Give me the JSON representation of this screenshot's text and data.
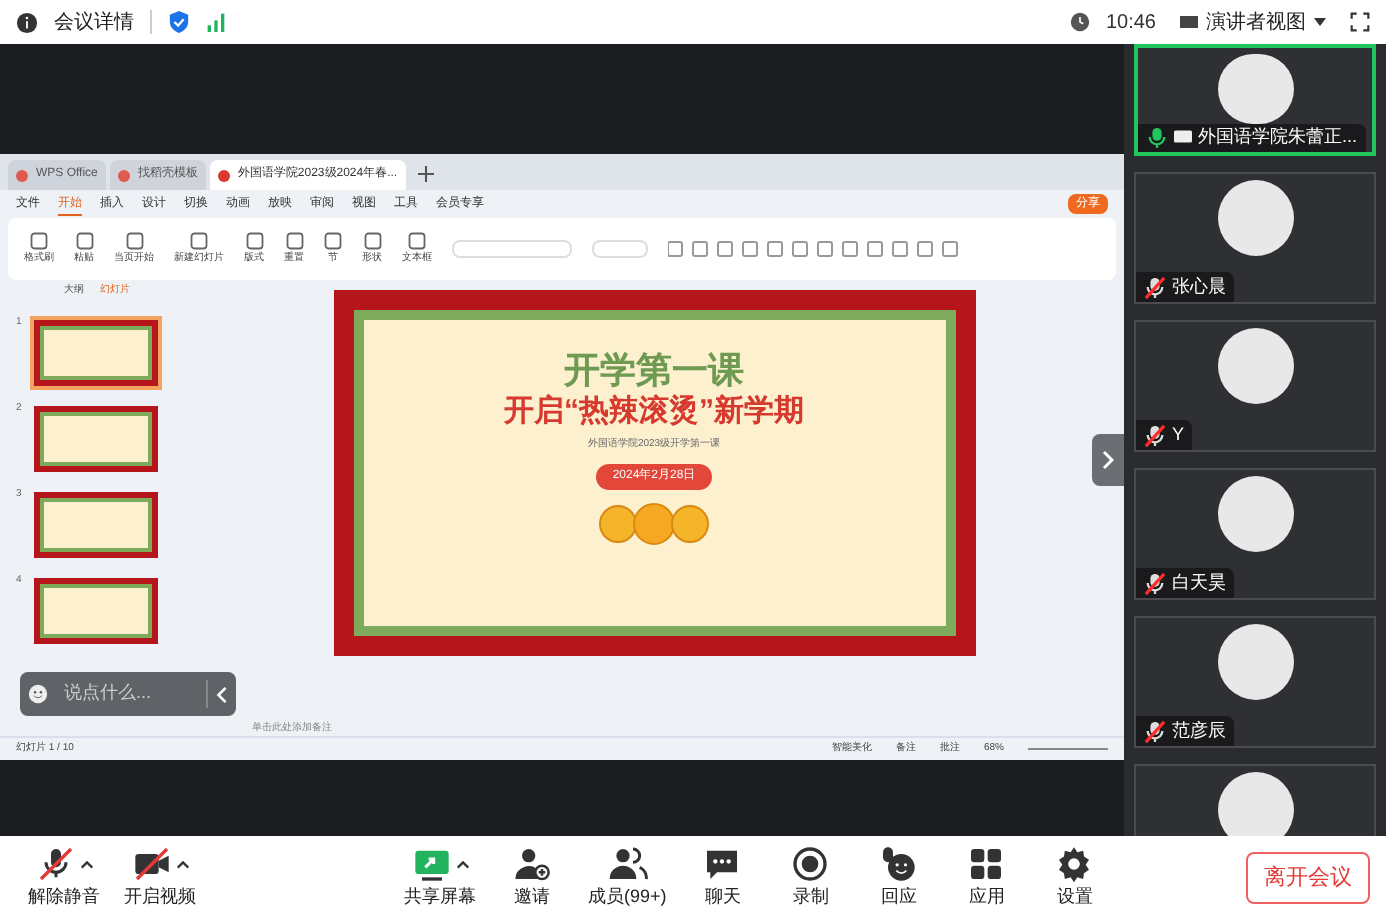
{
  "top_bar": {
    "meeting_info": "会议详情",
    "time": "10:46",
    "view_mode": "演讲者视图"
  },
  "wps": {
    "tabs": [
      {
        "label": "WPS Office",
        "selected": false
      },
      {
        "label": "找稻壳模板",
        "selected": false
      },
      {
        "label": "外国语学院2023级2024年春...",
        "selected": true
      }
    ],
    "menu": [
      {
        "label": "文件",
        "selected": false
      },
      {
        "label": "开始",
        "selected": true
      },
      {
        "label": "插入",
        "selected": false
      },
      {
        "label": "设计",
        "selected": false
      },
      {
        "label": "切换",
        "selected": false
      },
      {
        "label": "动画",
        "selected": false
      },
      {
        "label": "放映",
        "selected": false
      },
      {
        "label": "审阅",
        "selected": false
      },
      {
        "label": "视图",
        "selected": false
      },
      {
        "label": "工具",
        "selected": false
      },
      {
        "label": "会员专享",
        "selected": false
      }
    ],
    "share_button": "分享",
    "ribbon": [
      {
        "label": "格式刷"
      },
      {
        "label": "粘贴"
      },
      {
        "label": "当页开始"
      },
      {
        "label": "新建幻灯片"
      },
      {
        "label": "版式"
      },
      {
        "label": "重置"
      },
      {
        "label": "节"
      },
      {
        "label": "形状"
      },
      {
        "label": "文本框"
      }
    ],
    "pane_tabs": [
      {
        "label": "大纲",
        "selected": false
      },
      {
        "label": "幻灯片",
        "selected": true
      }
    ],
    "thumbnails": [
      {
        "number": "1",
        "selected": true
      },
      {
        "number": "2",
        "selected": false
      },
      {
        "number": "3",
        "selected": false
      },
      {
        "number": "4",
        "selected": false
      }
    ],
    "slide": {
      "title": "开学第一课",
      "subtitle": "开启“热辣滚烫”新学期",
      "caption": "外国语学院2023级开学第一课",
      "date": "2024年2月28日"
    },
    "notes_placeholder": "单击此处添加备注",
    "status": {
      "slide_count": "幻灯片 1 / 10",
      "beautify": "智能美化",
      "notes": "备注",
      "comments": "批注",
      "zoom": "68%"
    },
    "chat_placeholder": "说点什么..."
  },
  "participants": [
    {
      "name": "外国语学院朱蕾正...",
      "mic_on": true,
      "speaking": true,
      "sharing": true
    },
    {
      "name": "张心晨",
      "mic_on": false,
      "speaking": false,
      "sharing": false
    },
    {
      "name": "Y",
      "mic_on": false,
      "speaking": false,
      "sharing": false
    },
    {
      "name": "白天昊",
      "mic_on": false,
      "speaking": false,
      "sharing": false
    },
    {
      "name": "范彦辰",
      "mic_on": false,
      "speaking": false,
      "sharing": false
    },
    {
      "speaking": false
    }
  ],
  "toolbar": [
    {
      "kind": "mic",
      "label": "解除静音",
      "off": true,
      "caret": true
    },
    {
      "kind": "video",
      "label": "开启视频",
      "off": true,
      "caret": true
    },
    {
      "kind": "share",
      "label": "共享屏幕",
      "caret": true
    },
    {
      "kind": "invite",
      "label": "邀请",
      "caret": false
    },
    {
      "kind": "members",
      "label": "成员(99+)",
      "caret": false
    },
    {
      "kind": "chat",
      "label": "聊天",
      "caret": false
    },
    {
      "kind": "record",
      "label": "录制",
      "caret": false
    },
    {
      "kind": "react",
      "label": "回应",
      "caret": false
    },
    {
      "kind": "apps",
      "label": "应用",
      "caret": false
    },
    {
      "kind": "settings",
      "label": "设置",
      "caret": false
    }
  ],
  "leave_button": "离开会议"
}
